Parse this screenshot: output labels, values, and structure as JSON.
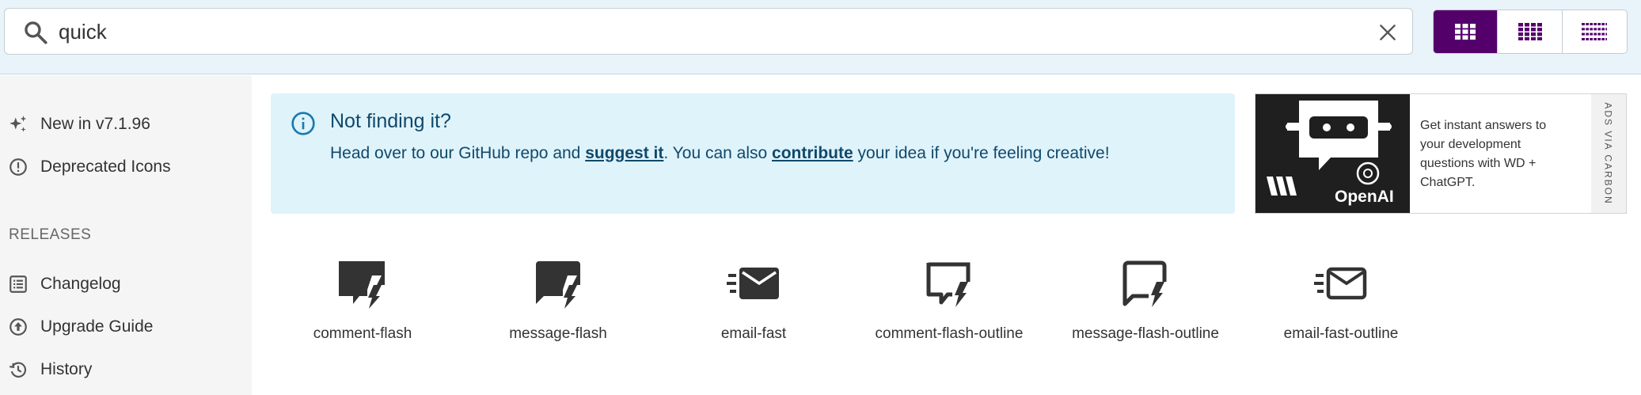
{
  "search": {
    "value": "quick",
    "placeholder": ""
  },
  "view_modes": [
    {
      "name": "large",
      "active": true
    },
    {
      "name": "medium",
      "active": false
    },
    {
      "name": "small",
      "active": false
    }
  ],
  "colors": {
    "accent": "#54006b",
    "topbar": "#e8f4f9",
    "notice_bg": "#dff3fb",
    "notice_text": "#10496b",
    "icon_fill": "#333333"
  },
  "sidebar": {
    "items": [
      {
        "label": "New in v7.1.96",
        "icon": "sparkle-icon"
      },
      {
        "label": "Deprecated Icons",
        "icon": "alert-circle-icon"
      }
    ],
    "releases_heading": "RELEASES",
    "release_items": [
      {
        "label": "Changelog",
        "icon": "list-box-icon"
      },
      {
        "label": "Upgrade Guide",
        "icon": "arrow-up-circle-icon"
      },
      {
        "label": "History",
        "icon": "history-icon"
      }
    ]
  },
  "notice": {
    "title": "Not finding it?",
    "body_prefix": "Head over to our GitHub repo and ",
    "link_suggest": "suggest it",
    "body_middle": ". You can also ",
    "link_contribute": "contribute",
    "body_suffix": " your idea if you're feeling creative!"
  },
  "ad": {
    "brand_text": "OpenAI",
    "text": "Get instant answers to your development questions with WD + ChatGPT.",
    "via": "ADS VIA CARBON"
  },
  "results": [
    {
      "label": "comment-flash",
      "icon": "comment-flash-icon"
    },
    {
      "label": "message-flash",
      "icon": "message-flash-icon"
    },
    {
      "label": "email-fast",
      "icon": "email-fast-icon"
    },
    {
      "label": "comment-flash-outline",
      "icon": "comment-flash-outline-icon"
    },
    {
      "label": "message-flash-outline",
      "icon": "message-flash-outline-icon"
    },
    {
      "label": "email-fast-outline",
      "icon": "email-fast-outline-icon"
    }
  ]
}
